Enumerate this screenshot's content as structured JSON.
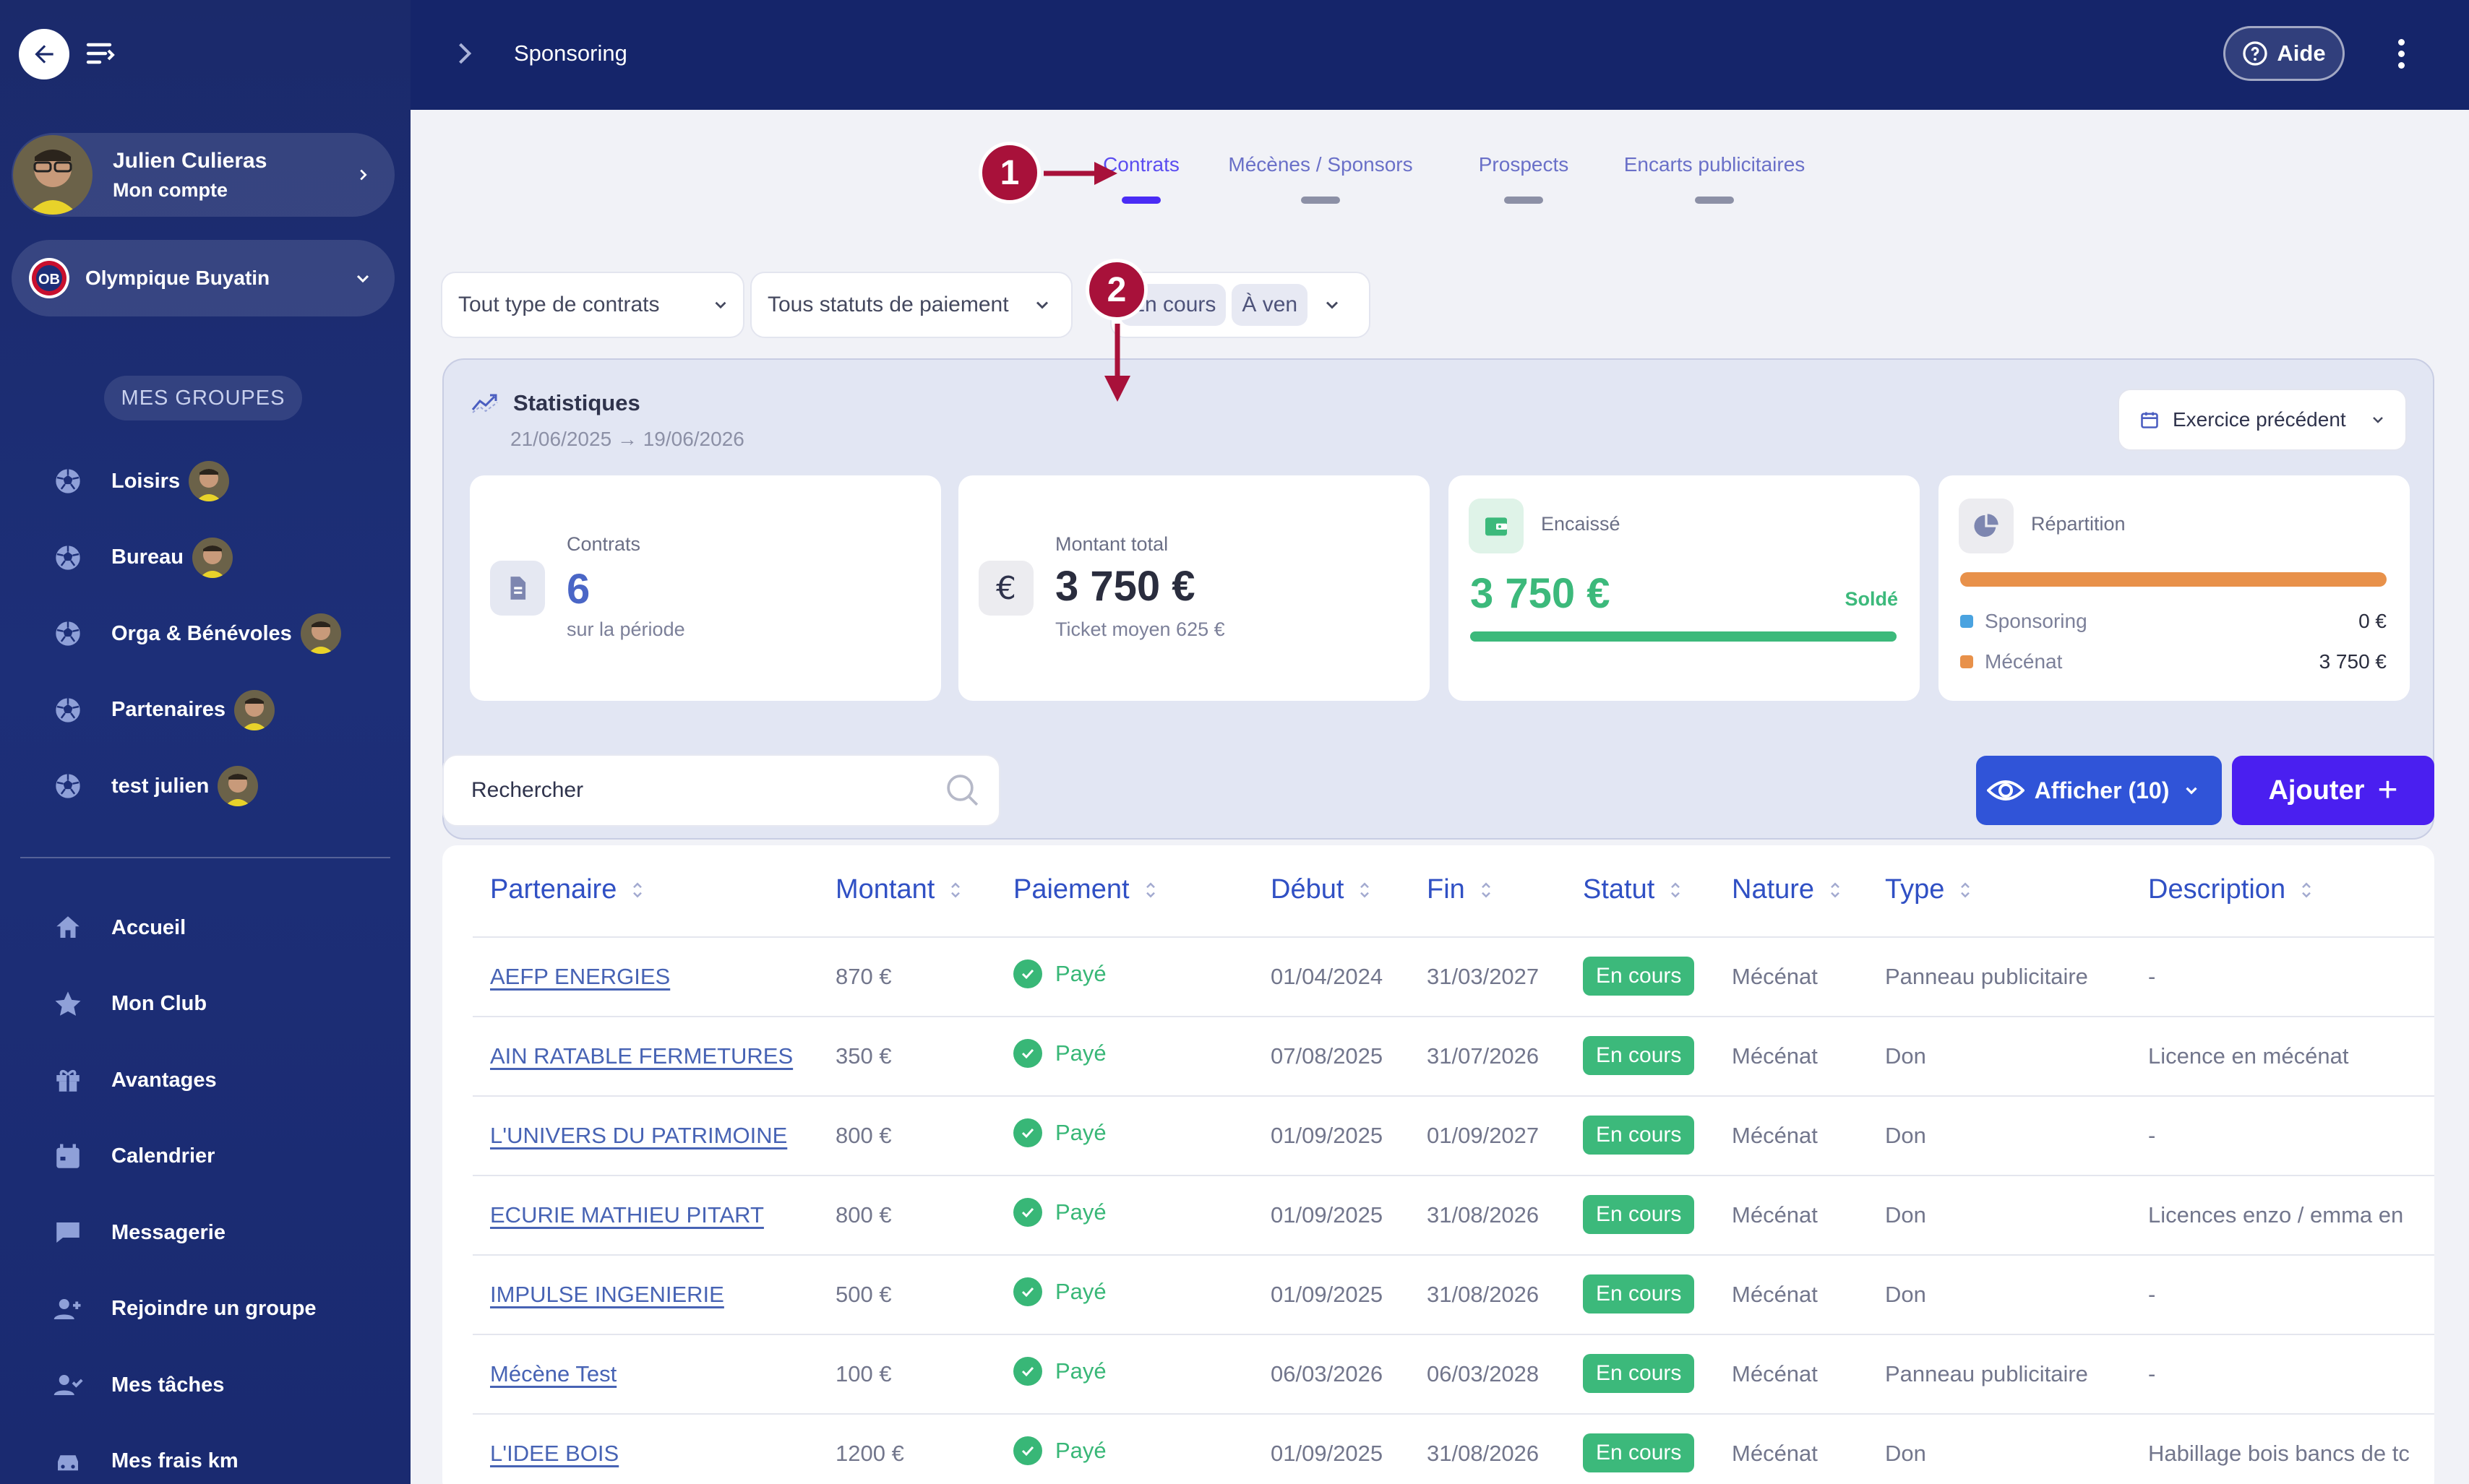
{
  "topbar": {
    "title": "Sponsoring",
    "help_label": "Aide"
  },
  "sidebar": {
    "user_name": "Julien Culieras",
    "user_sub": "Mon compte",
    "club_name": "Olympique Buyatin",
    "groups_label": "MES GROUPES",
    "groups": [
      {
        "label": "Loisirs"
      },
      {
        "label": "Bureau"
      },
      {
        "label": "Orga & Bénévoles"
      },
      {
        "label": "Partenaires"
      },
      {
        "label": "test julien"
      }
    ],
    "nav": [
      {
        "label": "Accueil",
        "icon": "home-icon"
      },
      {
        "label": "Mon Club",
        "icon": "star-icon"
      },
      {
        "label": "Avantages",
        "icon": "gift-icon"
      },
      {
        "label": "Calendrier",
        "icon": "calendar-icon"
      },
      {
        "label": "Messagerie",
        "icon": "chat-icon"
      },
      {
        "label": "Rejoindre un groupe",
        "icon": "user-plus-icon"
      },
      {
        "label": "Mes tâches",
        "icon": "user-check-icon"
      },
      {
        "label": "Mes frais km",
        "icon": "car-icon"
      }
    ]
  },
  "tabs": [
    {
      "label": "Contrats",
      "active": true
    },
    {
      "label": "Mécènes / Sponsors",
      "active": false
    },
    {
      "label": "Prospects",
      "active": false
    },
    {
      "label": "Encarts publicitaires",
      "active": false
    }
  ],
  "filters": {
    "type": "Tout type de contrats",
    "payment": "Tous statuts de paiement",
    "status_chips": [
      "En cours",
      "À ven"
    ]
  },
  "stats": {
    "title": "Statistiques",
    "period": "21/06/2025 → 19/06/2026",
    "period_select": "Exercice précédent",
    "contracts_label": "Contrats",
    "contracts_value": "6",
    "contracts_sub": "sur la période",
    "total_label": "Montant total",
    "total_value": "3 750 €",
    "total_sub": "Ticket moyen 625 €",
    "cashed_label": "Encaissé",
    "cashed_value": "3 750 €",
    "cashed_status": "Soldé",
    "cashed_progress": 1.0,
    "split_label": "Répartition",
    "split_rows": [
      {
        "label": "Sponsoring",
        "value": "0 €",
        "color": "#4aa3e0"
      },
      {
        "label": "Mécénat",
        "value": "3 750 €",
        "color": "#e8914a"
      }
    ]
  },
  "search": {
    "placeholder": "Rechercher"
  },
  "actions": {
    "show_label": "Afficher (10)",
    "add_label": "Ajouter"
  },
  "table": {
    "headers": [
      "Partenaire",
      "Montant",
      "Paiement",
      "Début",
      "Fin",
      "Statut",
      "Nature",
      "Type",
      "Description"
    ],
    "rows": [
      {
        "partner": "AEFP ENERGIES",
        "amount": "870 €",
        "payment": "Payé",
        "start": "01/04/2024",
        "end": "31/03/2027",
        "status": "En cours",
        "nature": "Mécénat",
        "type": "Panneau publicitaire",
        "description": "-"
      },
      {
        "partner": "AIN RATABLE FERMETURES",
        "amount": "350 €",
        "payment": "Payé",
        "start": "07/08/2025",
        "end": "31/07/2026",
        "status": "En cours",
        "nature": "Mécénat",
        "type": "Don",
        "description": "Licence en mécénat"
      },
      {
        "partner": "L'UNIVERS DU PATRIMOINE",
        "amount": "800 €",
        "payment": "Payé",
        "start": "01/09/2025",
        "end": "01/09/2027",
        "status": "En cours",
        "nature": "Mécénat",
        "type": "Don",
        "description": "-"
      },
      {
        "partner": "ECURIE MATHIEU PITART",
        "amount": "800 €",
        "payment": "Payé",
        "start": "01/09/2025",
        "end": "31/08/2026",
        "status": "En cours",
        "nature": "Mécénat",
        "type": "Don",
        "description": "Licences enzo / emma en"
      },
      {
        "partner": "IMPULSE INGENIERIE",
        "amount": "500 €",
        "payment": "Payé",
        "start": "01/09/2025",
        "end": "31/08/2026",
        "status": "En cours",
        "nature": "Mécénat",
        "type": "Don",
        "description": "-"
      },
      {
        "partner": "Mécène Test",
        "amount": "100 €",
        "payment": "Payé",
        "start": "06/03/2026",
        "end": "06/03/2028",
        "status": "En cours",
        "nature": "Mécénat",
        "type": "Panneau publicitaire",
        "description": "-"
      },
      {
        "partner": "L'IDEE BOIS",
        "amount": "1200 €",
        "payment": "Payé",
        "start": "01/09/2025",
        "end": "31/08/2026",
        "status": "En cours",
        "nature": "Mécénat",
        "type": "Don",
        "description": "Habillage bois bancs de tc"
      }
    ]
  },
  "annotations": [
    "1",
    "2"
  ]
}
